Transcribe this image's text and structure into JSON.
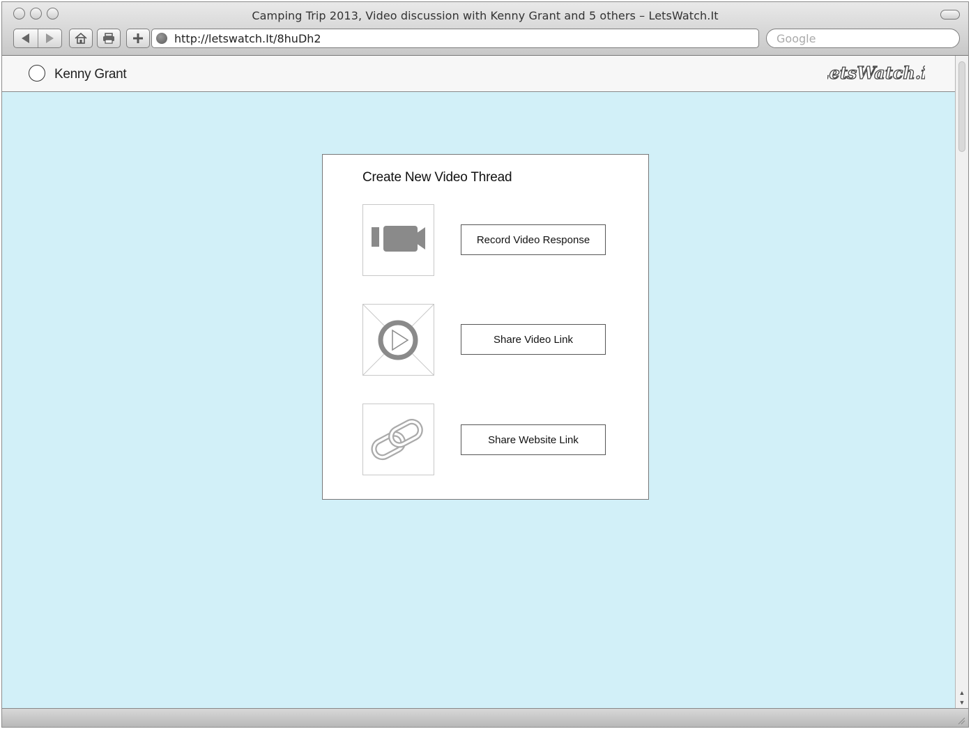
{
  "browser": {
    "window_title": "Camping Trip 2013, Video discussion with Kenny Grant and 5 others – LetsWatch.It",
    "url": "http://letswatch.It/8huDh2",
    "search_placeholder": "Google"
  },
  "site": {
    "user_name": "Kenny Grant",
    "logo_text": "LetsWatch.it"
  },
  "dialog": {
    "title": "Create New Video Thread",
    "options": [
      {
        "icon": "video-camera-icon",
        "label": "Record Video Response"
      },
      {
        "icon": "video-play-placeholder-icon",
        "label": "Share Video Link"
      },
      {
        "icon": "link-chain-icon",
        "label": "Share Website Link"
      }
    ]
  },
  "colors": {
    "page_background": "#d2f0f8",
    "icon_gray": "#8a8a8a"
  }
}
